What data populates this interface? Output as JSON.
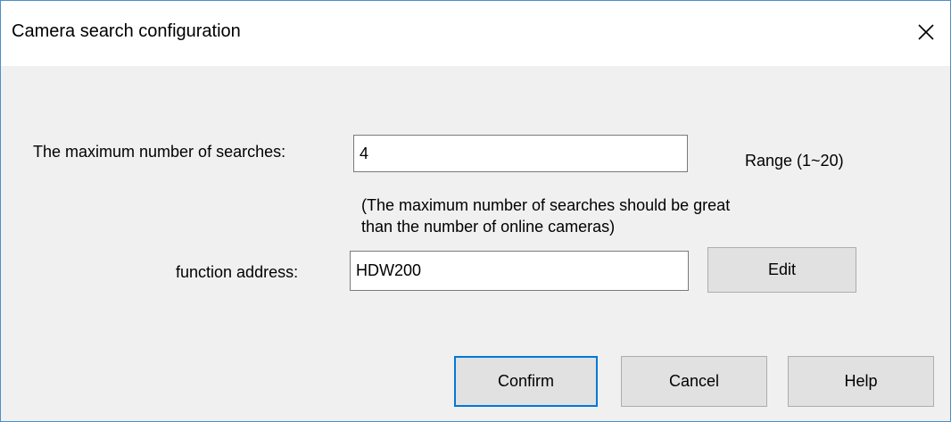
{
  "window": {
    "title": "Camera search configuration",
    "close_icon": "close-icon"
  },
  "form": {
    "max_searches": {
      "label": "The maximum number of searches:",
      "value": "4",
      "range_hint": "Range (1~20)"
    },
    "note": {
      "line1": "(The maximum number of searches should be great",
      "line2": "than the number of online cameras)"
    },
    "function_address": {
      "label": "function address:",
      "value": "HDW200",
      "edit_label": "Edit"
    }
  },
  "buttons": {
    "confirm_label": "Confirm",
    "cancel_label": "Cancel",
    "help_label": "Help"
  },
  "colors": {
    "focus_accent": "#0078d7",
    "dialog_background": "#f0f0f0",
    "button_face": "#e1e1e1"
  }
}
